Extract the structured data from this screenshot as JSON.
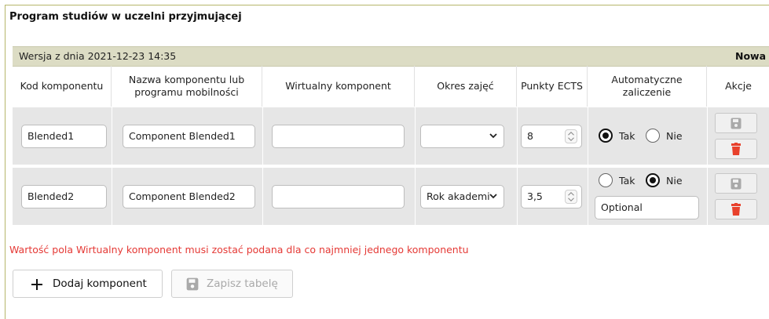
{
  "section_title": "Program studiów w uczelni przyjmującej",
  "version": {
    "label": "Wersja z dnia 2021-12-23 14:35",
    "right_label": "Nowa"
  },
  "headers": [
    "Kod komponentu",
    "Nazwa komponentu lub programu mobilności",
    "Wirtualny komponent",
    "Okres zajęć",
    "Punkty ECTS",
    "Automatyczne zaliczenie",
    "Akcje"
  ],
  "rows": [
    {
      "code": "Blended1",
      "name": "Component Blended1",
      "virtual": "",
      "period": "",
      "ects": "8",
      "auto_yes_label": "Tak",
      "auto_no_label": "Nie",
      "auto_selected": "Tak",
      "note": ""
    },
    {
      "code": "Blended2",
      "name": "Component Blended2",
      "virtual": "",
      "period": "Rok akademi",
      "ects": "3,5",
      "auto_yes_label": "Tak",
      "auto_no_label": "Nie",
      "auto_selected": "Nie",
      "note": "Optional"
    }
  ],
  "error_message": "Wartość pola Wirtualny komponent musi zostać podana dla co najmniej jednego komponentu",
  "buttons": {
    "add": "Dodaj komponent",
    "save_table": "Zapisz tabelę"
  },
  "icons": {
    "save": "floppy-disk-icon",
    "delete": "trash-icon",
    "add": "plus-icon",
    "dropdown": "chevron-down-icon",
    "spinner": "spinner-updown-icon"
  },
  "colors": {
    "version_bar": "#dcdcc4",
    "row_bg": "#e6e6e6",
    "error": "#e53935",
    "delete_icon": "#e8412c",
    "save_icon_disabled": "#a9a9a9"
  }
}
